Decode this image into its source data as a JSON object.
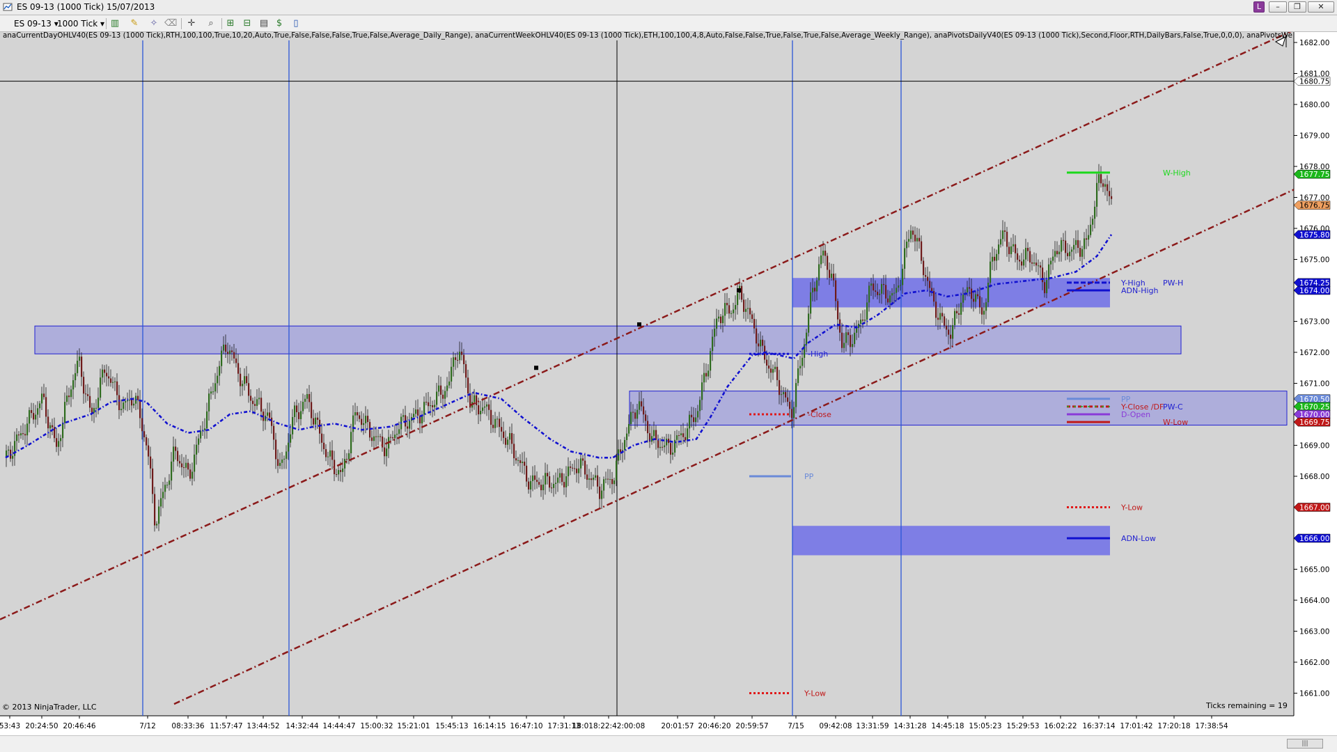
{
  "window": {
    "title": "ES 09-13 (1000 Tick)  15/07/2013",
    "buttons": [
      "L",
      "–",
      "❐",
      "✕"
    ]
  },
  "toolbar": {
    "instrument": "ES 09-13",
    "interval": "1000 Tick",
    "icons": [
      "bars-icon",
      "pencil-icon",
      "magic-wand-icon",
      "eraser-icon",
      "crosshair-icon",
      "zoom-icon",
      "indicators-icon",
      "strategies-icon",
      "properties-icon",
      "dollar-icon",
      "data-box-icon"
    ]
  },
  "indicator_label": "anaCurrentDayOHLV40(ES 09-13 (1000 Tick),RTH,100,100,True,10,20,Auto,True,False,False,False,True,False,Average_Daily_Range), anaCurrentWeekOHLV40(ES 09-13 (1000 Tick),ETH,100,100,4,8,Auto,False,False,True,False,True,False,Average_Weekly_Range), anaPivotsDailyV40(ES 09-13 (1000 Tick),Second,Floor,RTH,DailyBars,False,True,0,0,0), anaPivotsWe",
  "copyright": "© 2013 NinjaTrader, LLC",
  "ticks_remaining": "Ticks remaining = 19",
  "colors": {
    "background": "#d4d4d4",
    "separator": "#2a55d8",
    "trend": "#8b1a1a",
    "ma": "#1010d0",
    "zone": "#6868e8",
    "up_bar": "#2e6b1e",
    "down_bar": "#6e1a1a"
  },
  "price_axis": {
    "ticks": [
      "1682.00",
      "1681.00",
      "1680.00",
      "1679.00",
      "1678.00",
      "1677.00",
      "1676.00",
      "1675.00",
      "1674.00",
      "1673.00",
      "1672.00",
      "1671.00",
      "1670.00",
      "1669.00",
      "1668.00",
      "1667.00",
      "1666.00",
      "1665.00",
      "1664.00",
      "1663.00",
      "1662.00",
      "1661.00"
    ],
    "markers": [
      {
        "text": "1680.75",
        "bg": "#ffffff",
        "fg": "#000000"
      },
      {
        "text": "1677.75",
        "bg": "#1bb81b",
        "fg": "#ffffff"
      },
      {
        "text": "1676.75",
        "bg": "#f0a060",
        "fg": "#000000"
      },
      {
        "text": "1675.80",
        "bg": "#1010d0",
        "fg": "#ffffff"
      },
      {
        "text": "1674.25",
        "bg": "#1010d0",
        "fg": "#ffffff"
      },
      {
        "text": "1674.00",
        "bg": "#1010d0",
        "fg": "#ffffff"
      },
      {
        "text": "1670.50",
        "bg": "#6a8ad8",
        "fg": "#ffffff"
      },
      {
        "text": "1670.25",
        "bg": "#1bb81b",
        "fg": "#ffffff"
      },
      {
        "text": "1670.00",
        "bg": "#8a3ad8",
        "fg": "#ffffff"
      },
      {
        "text": "1669.75",
        "bg": "#c01818",
        "fg": "#ffffff"
      },
      {
        "text": "1667.00",
        "bg": "#c01818",
        "fg": "#ffffff"
      },
      {
        "text": "1666.00",
        "bg": "#1010d0",
        "fg": "#ffffff"
      }
    ]
  },
  "time_axis": [
    "53:43",
    "20:24:50",
    "20:46:46",
    "7/12",
    "08:33:36",
    "11:57:47",
    "13:44:52",
    "14:32:44",
    "14:44:47",
    "15:00:32",
    "15:21:01",
    "15:45:13",
    "16:14:15",
    "16:47:10",
    "17:31:13",
    "18:018:22:42:00:08",
    "20:01:57",
    "20:46:20",
    "20:59:57",
    "7/15",
    "09:42:08",
    "13:31:59",
    "14:31:28",
    "14:45:18",
    "15:05:23",
    "15:29:53",
    "16:02:22",
    "16:37:14",
    "17:01:42",
    "17:20:18",
    "17:38:54"
  ],
  "level_labels": [
    {
      "text": "W-High",
      "color": "#1bd81b"
    },
    {
      "text": "Y-High",
      "color": "#2020d0"
    },
    {
      "text": "PW-H",
      "color": "#2020d0"
    },
    {
      "text": "ADN-High",
      "color": "#2020d0"
    },
    {
      "text": "PP",
      "color": "#6a8ad8"
    },
    {
      "text": "Y-Close /DF",
      "color": "#c01818"
    },
    {
      "text": "PW-C",
      "color": "#2020d0"
    },
    {
      "text": "D-Open",
      "color": "#8a3ad8"
    },
    {
      "text": "W-Low",
      "color": "#c01818"
    },
    {
      "text": "Y-Low",
      "color": "#c01818"
    },
    {
      "text": "ADN-Low",
      "color": "#2020d0"
    },
    {
      "text": "-High",
      "color": "#2020d0"
    },
    {
      "text": "-Close",
      "color": "#c01818"
    },
    {
      "text": "PP",
      "color": "#6a8ad8"
    },
    {
      "text": "Y-Low",
      "color": "#c01818"
    }
  ]
}
